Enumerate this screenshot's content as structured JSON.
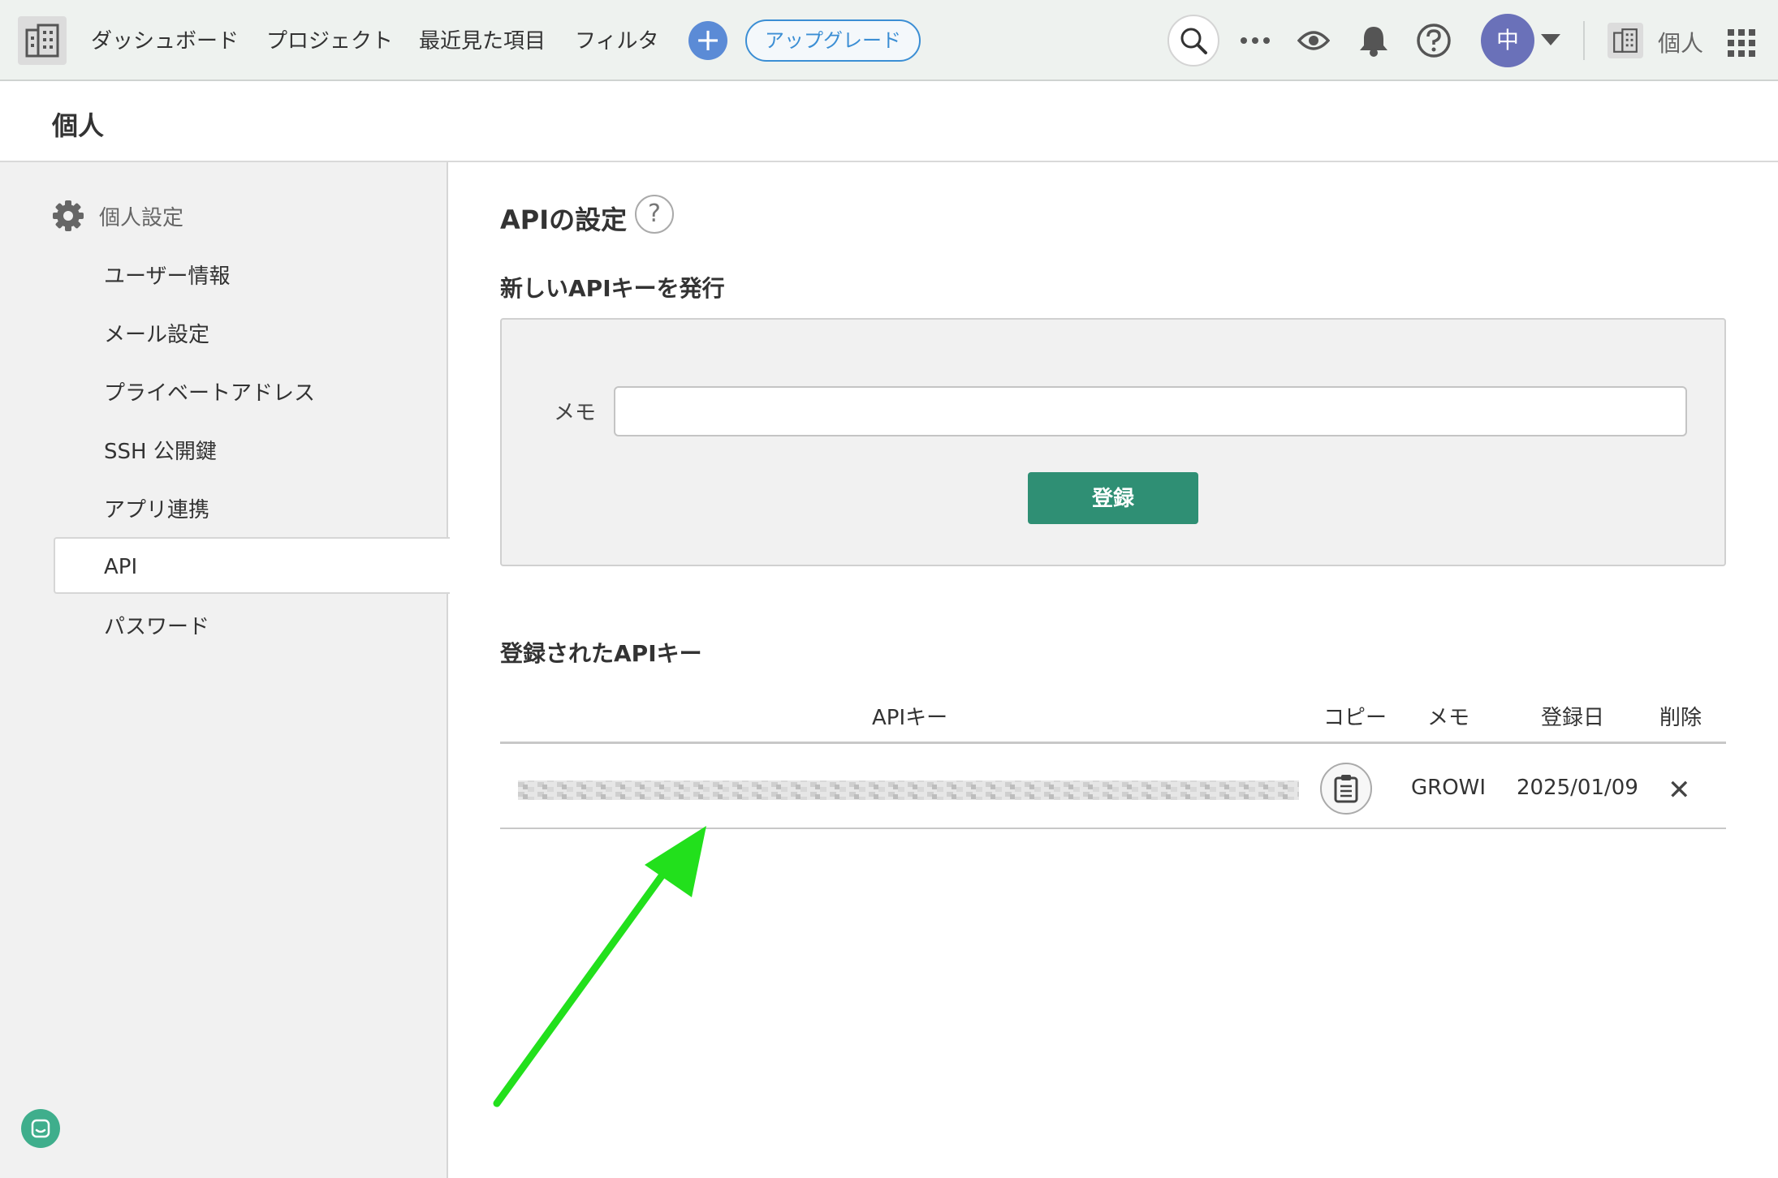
{
  "topbar": {
    "nav": [
      "ダッシュボード",
      "プロジェクト",
      "最近見た項目",
      "フィルタ"
    ],
    "create_label": "+",
    "upgrade_label": "アップグレード",
    "avatar_initial": "中",
    "workspace_label": "個人"
  },
  "page": {
    "title": "個人"
  },
  "sidebar": {
    "heading": "個人設定",
    "items": [
      {
        "label": "ユーザー情報"
      },
      {
        "label": "メール設定"
      },
      {
        "label": "プライベートアドレス"
      },
      {
        "label": "SSH 公開鍵"
      },
      {
        "label": "アプリ連携"
      },
      {
        "label": "API",
        "active": true
      },
      {
        "label": "パスワード"
      }
    ]
  },
  "main": {
    "title": "APIの設定",
    "help_label": "?",
    "new_key": {
      "title": "新しいAPIキーを発行",
      "memo_label": "メモ",
      "memo_value": "",
      "submit_label": "登録"
    },
    "keys": {
      "title": "登録されたAPIキー",
      "columns": [
        "APIキー",
        "コピー",
        "メモ",
        "登録日",
        "削除"
      ],
      "rows": [
        {
          "api_key": "",
          "memo": "GROWI",
          "date": "2025/01/09",
          "delete_label": "✕"
        }
      ]
    }
  },
  "colors": {
    "accent_green": "#2f8f74",
    "upgrade_blue": "#3b8ed4",
    "avatar_purple": "#6a71b9",
    "annotation_arrow": "#22e01c"
  }
}
